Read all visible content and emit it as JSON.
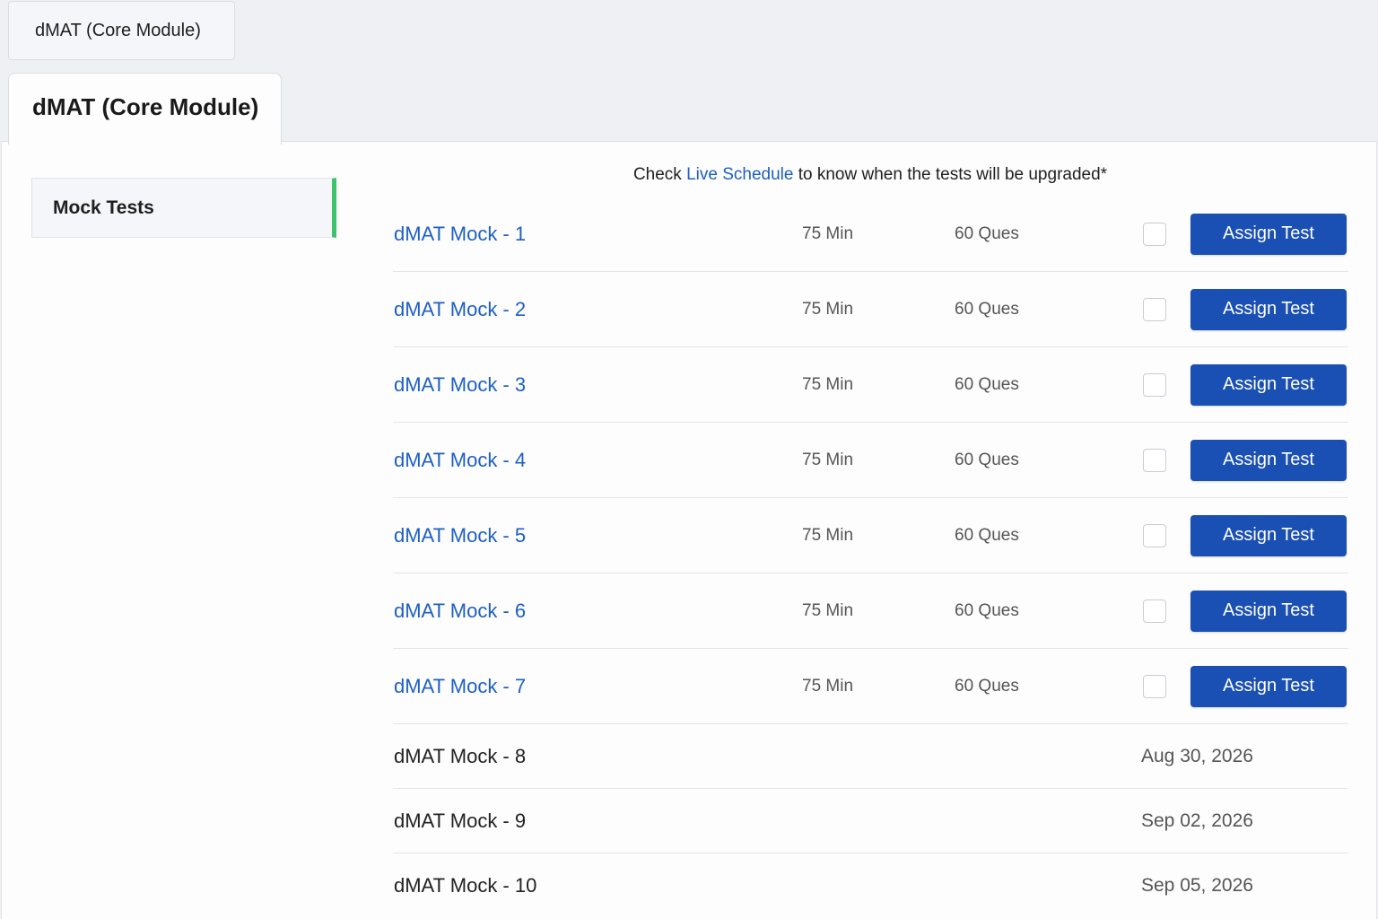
{
  "tabs": {
    "top_label": "dMAT (Core Module)",
    "active_label": "dMAT (Core Module)"
  },
  "sidebar": {
    "items": [
      {
        "label": "Mock Tests",
        "selected": true
      }
    ]
  },
  "notice": {
    "prefix": "Check",
    "link": "Live Schedule",
    "suffix": "to know when the tests will be upgraded*"
  },
  "tests": [
    {
      "name": "dMAT Mock - 1",
      "duration": "75 Min",
      "questions": "60 Ques",
      "action": "Assign Test"
    },
    {
      "name": "dMAT Mock - 2",
      "duration": "75 Min",
      "questions": "60 Ques",
      "action": "Assign Test"
    },
    {
      "name": "dMAT Mock - 3",
      "duration": "75 Min",
      "questions": "60 Ques",
      "action": "Assign Test"
    },
    {
      "name": "dMAT Mock - 4",
      "duration": "75 Min",
      "questions": "60 Ques",
      "action": "Assign Test"
    },
    {
      "name": "dMAT Mock - 5",
      "duration": "75 Min",
      "questions": "60 Ques",
      "action": "Assign Test"
    },
    {
      "name": "dMAT Mock - 6",
      "duration": "75 Min",
      "questions": "60 Ques",
      "action": "Assign Test"
    },
    {
      "name": "dMAT Mock - 7",
      "duration": "75 Min",
      "questions": "60 Ques",
      "action": "Assign Test"
    }
  ],
  "upcoming": [
    {
      "name": "dMAT Mock - 8",
      "date": "Aug 30, 2026"
    },
    {
      "name": "dMAT Mock - 9",
      "date": "Sep 02, 2026"
    },
    {
      "name": "dMAT Mock - 10",
      "date": "Sep 05, 2026"
    }
  ],
  "colors": {
    "accent_blue": "#1a4fb3",
    "link_blue": "#1d5fc4",
    "active_indicator": "#3cc36b"
  }
}
